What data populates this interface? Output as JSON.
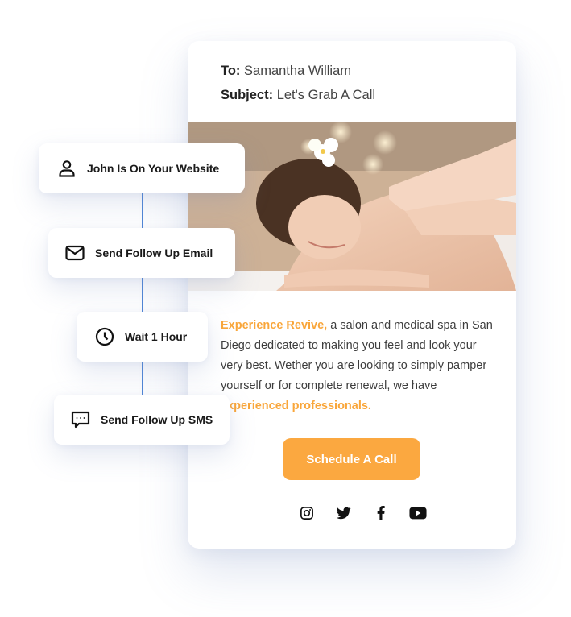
{
  "email": {
    "to_label": "To:",
    "to_value": "Samantha William",
    "subject_label": "Subject:",
    "subject_value": "Let's Grab A Call",
    "hero_image_alt": "Woman receiving a relaxing shoulder massage at a spa",
    "body": {
      "highlight_start": "Experience Revive,",
      "text_main": " a salon and medical spa in San Diego dedicated to making you feel and look your very best. Wether you are looking to simply pamper yourself or for complete renewal, we have ",
      "highlight_end": "experienced professionals."
    },
    "cta_label": "Schedule A Call",
    "socials": [
      {
        "name": "instagram",
        "icon": "instagram-icon"
      },
      {
        "name": "twitter",
        "icon": "twitter-icon"
      },
      {
        "name": "facebook",
        "icon": "facebook-icon"
      },
      {
        "name": "youtube",
        "icon": "youtube-icon"
      }
    ]
  },
  "workflow": {
    "accent_color": "#4f86d6",
    "steps": [
      {
        "label": "John Is On Your Website",
        "icon": "user-icon"
      },
      {
        "label": "Send Follow Up Email",
        "icon": "mail-icon"
      },
      {
        "label": "Wait 1 Hour",
        "icon": "clock-icon"
      },
      {
        "label": "Send Follow Up SMS",
        "icon": "sms-chat-icon"
      }
    ]
  },
  "colors": {
    "highlight": "#f9a63a",
    "cta_background": "#fba840",
    "text": "#3d3d3d"
  }
}
